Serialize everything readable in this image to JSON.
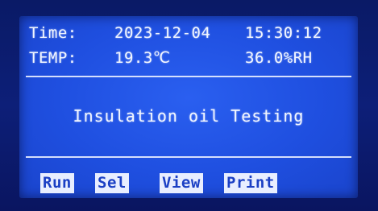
{
  "status": {
    "time_label": "Time:",
    "date": "2023-12-04",
    "time": "15:30:12",
    "temp_label": "TEMP:",
    "temp_value": "19.3℃",
    "humidity": "36.0%RH"
  },
  "main": {
    "title": "Insulation oil Testing"
  },
  "softkeys": [
    {
      "label": "Run"
    },
    {
      "label": "Sel"
    },
    {
      "label": "View"
    },
    {
      "label": "Print"
    }
  ],
  "colors": {
    "screen_bg": "#1f4fe0",
    "text": "#f2f6ff",
    "softkey_bg": "#e8eeff",
    "softkey_text": "#1a3fc4"
  }
}
